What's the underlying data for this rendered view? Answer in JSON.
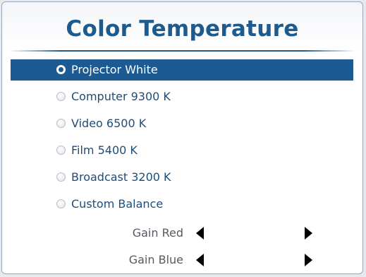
{
  "title": "Color Temperature",
  "options": [
    {
      "label": "Projector White",
      "selected": true
    },
    {
      "label": "Computer 9300 K",
      "selected": false
    },
    {
      "label": "Video 6500 K",
      "selected": false
    },
    {
      "label": "Film 5400 K",
      "selected": false
    },
    {
      "label": "Broadcast 3200 K",
      "selected": false
    },
    {
      "label": "Custom Balance",
      "selected": false
    }
  ],
  "gains": [
    {
      "label": "Gain Red"
    },
    {
      "label": "Gain Blue"
    }
  ],
  "colors": {
    "title": "#1d5a8e",
    "selection": "#1b5a93",
    "option_text": "#1f4d7a",
    "gain_text": "#555a60"
  }
}
